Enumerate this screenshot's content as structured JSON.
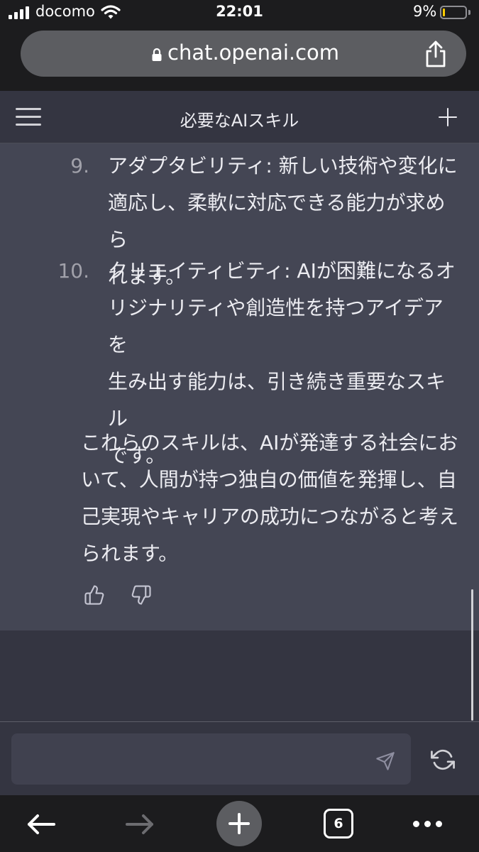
{
  "status_bar": {
    "carrier": "docomo",
    "time": "22:01",
    "battery": "9%"
  },
  "browser": {
    "url": "chat.openai.com",
    "tab_count": "6"
  },
  "chat": {
    "title": "必要なAIスキル"
  },
  "message": {
    "items": [
      {
        "number": "9.",
        "lines": [
          "アダプタビリティ: 新しい技術や変化に",
          "適応し、柔軟に対応できる能力が求めら",
          "れます。"
        ]
      },
      {
        "number": "10.",
        "lines": [
          "クリエイティビティ: AIが困難になるオ",
          "リジナリティや創造性を持つアイデアを",
          "生み出す能力は、引き続き重要なスキル",
          "です。"
        ]
      }
    ],
    "summary_lines": [
      "これらのスキルは、AIが発達する社会にお",
      "いて、人間が持つ独自の価値を発揮し、自",
      "己実現やキャリアの成功につながると考え",
      "られます。"
    ]
  },
  "composer": {
    "placeholder": ""
  },
  "icons": {
    "thumbs_up": "thumbs-up-icon",
    "thumbs_down": "thumbs-down-icon",
    "send": "send-icon",
    "regenerate": "refresh-icon",
    "lock": "lock-icon",
    "share": "share-icon"
  }
}
